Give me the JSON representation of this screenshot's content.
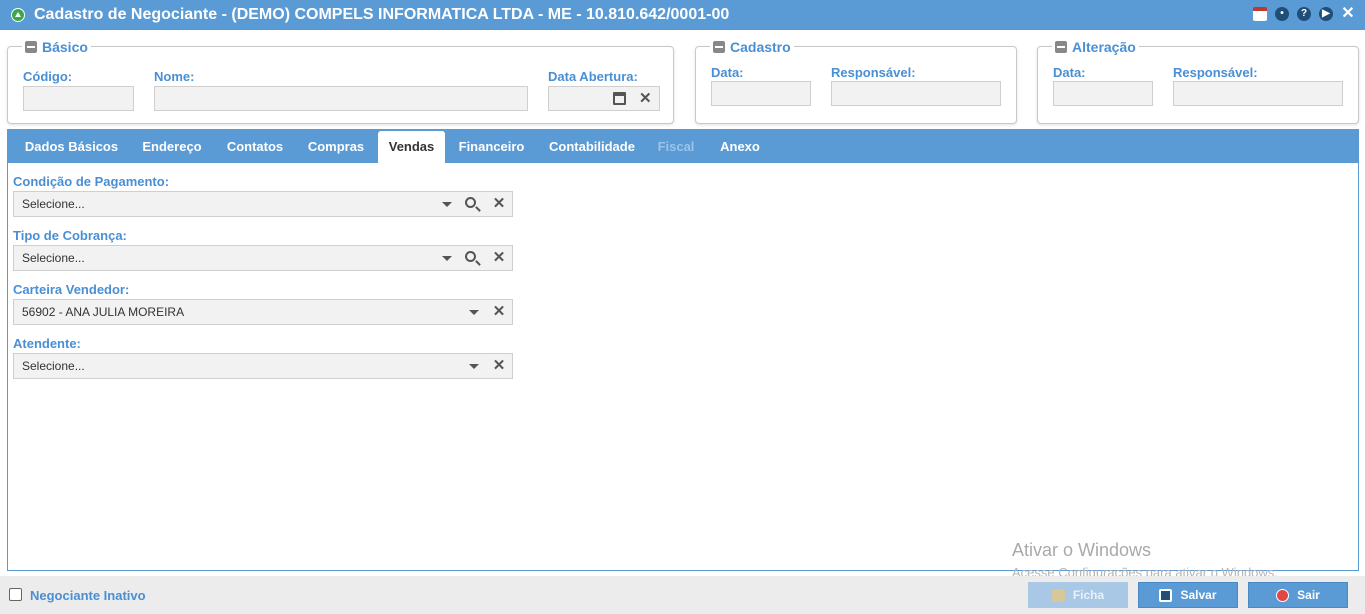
{
  "window": {
    "title": "Cadastro de Negociante - (DEMO) COMPELS INFORMATICA LTDA - ME - 10.810.642/0001-00",
    "icons": [
      "calendar-icon",
      "chat-icon",
      "help-icon",
      "play-icon",
      "close-icon"
    ]
  },
  "basico": {
    "legend": "Básico",
    "codigo_label": "Código:",
    "nome_label": "Nome:",
    "data_abertura_label": "Data Abertura:",
    "codigo": "",
    "nome": "",
    "data_abertura": ""
  },
  "cadastro": {
    "legend": "Cadastro",
    "data_label": "Data:",
    "responsavel_label": "Responsável:"
  },
  "alteracao": {
    "legend": "Alteração",
    "data_label": "Data:",
    "responsavel_label": "Responsável:"
  },
  "tabs": [
    {
      "label": "Dados Básicos",
      "state": "normal"
    },
    {
      "label": "Endereço",
      "state": "normal"
    },
    {
      "label": "Contatos",
      "state": "normal"
    },
    {
      "label": "Compras",
      "state": "normal"
    },
    {
      "label": "Vendas",
      "state": "active"
    },
    {
      "label": "Financeiro",
      "state": "normal"
    },
    {
      "label": "Contabilidade",
      "state": "normal"
    },
    {
      "label": "Fiscal",
      "state": "disabled"
    },
    {
      "label": "Anexo",
      "state": "normal"
    }
  ],
  "vendas": {
    "condicao_pagamento": {
      "label": "Condição de Pagamento:",
      "value": "Selecione..."
    },
    "tipo_cobranca": {
      "label": "Tipo de Cobrança:",
      "value": "Selecione..."
    },
    "carteira_vendedor": {
      "label": "Carteira Vendedor:",
      "value": "56902 - ANA JULIA MOREIRA"
    },
    "atendente": {
      "label": "Atendente:",
      "value": "Selecione..."
    }
  },
  "watermark": {
    "line1": "Ativar o Windows",
    "line2": "Acesse Configurações para ativar o Windows."
  },
  "footer": {
    "inativo_label": "Negociante Inativo",
    "ficha_label": "Ficha",
    "salvar_label": "Salvar",
    "sair_label": "Sair"
  },
  "colors": {
    "accent": "#5b9bd5",
    "label": "#4a8fd4"
  }
}
